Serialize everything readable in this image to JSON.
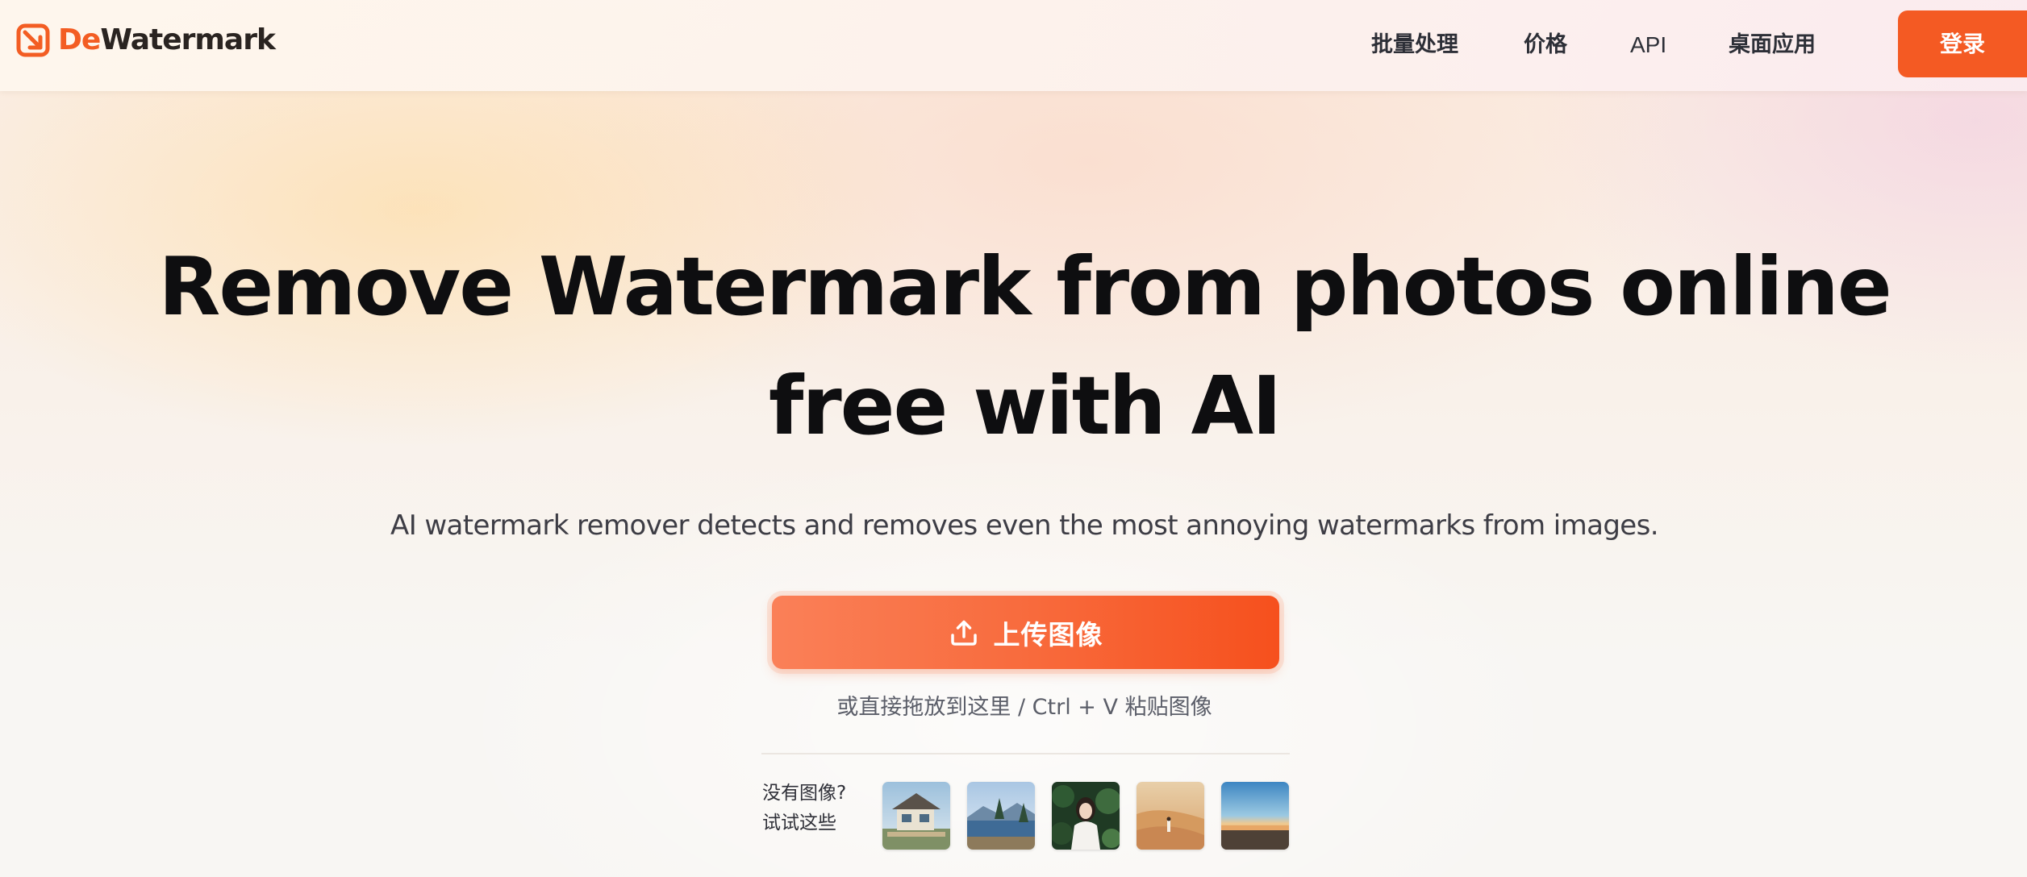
{
  "brand": {
    "name_accent": "De",
    "name_rest": "Watermark",
    "logo_icon": "watermark-eraser-icon",
    "accent_color": "#f45a23"
  },
  "nav": {
    "items": [
      {
        "label": "批量处理"
      },
      {
        "label": "价格"
      },
      {
        "label": "API"
      },
      {
        "label": "桌面应用"
      }
    ],
    "login_label": "登录"
  },
  "hero": {
    "title_line1": "Remove Watermark from photos online",
    "title_line2": "free with AI",
    "subtitle": "AI watermark remover detects and removes even the most annoying watermarks from images."
  },
  "upload": {
    "icon": "upload-icon",
    "label": "上传图像",
    "hint": "或直接拖放到这里 / Ctrl + V 粘贴图像"
  },
  "samples": {
    "label_line1": "没有图像?",
    "label_line2": "试试这些",
    "items": [
      {
        "subject": "house"
      },
      {
        "subject": "lake"
      },
      {
        "subject": "woman"
      },
      {
        "subject": "desert"
      },
      {
        "subject": "sunset-sea"
      }
    ]
  }
}
